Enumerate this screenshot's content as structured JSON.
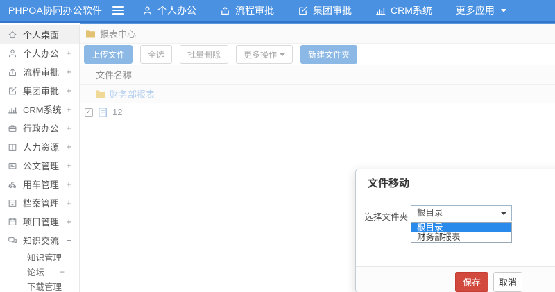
{
  "header": {
    "brand": "PHPOA协同办公软件",
    "nav": [
      {
        "label": "个人办公",
        "icon": "person-icon"
      },
      {
        "label": "流程审批",
        "icon": "process-icon"
      },
      {
        "label": "集团审批",
        "icon": "edit-icon"
      },
      {
        "label": "CRM系统",
        "icon": "chart-icon"
      },
      {
        "label": "更多应用",
        "icon": "caret-down-icon"
      }
    ]
  },
  "sidebar": {
    "items": [
      {
        "label": "个人桌面",
        "icon": "home-icon",
        "expand": "",
        "active": true
      },
      {
        "label": "个人办公",
        "icon": "person-icon",
        "expand": "+"
      },
      {
        "label": "流程审批",
        "icon": "process-icon",
        "expand": "+"
      },
      {
        "label": "集团审批",
        "icon": "edit-icon",
        "expand": "+"
      },
      {
        "label": "CRM系统",
        "icon": "chart-icon",
        "expand": "+"
      },
      {
        "label": "行政办公",
        "icon": "briefcase-icon",
        "expand": "+"
      },
      {
        "label": "人力资源",
        "icon": "book-icon",
        "expand": "+"
      },
      {
        "label": "公文管理",
        "icon": "document-icon",
        "expand": "+"
      },
      {
        "label": "用车管理",
        "icon": "car-icon",
        "expand": "+"
      },
      {
        "label": "档案管理",
        "icon": "archive-icon",
        "expand": "+"
      },
      {
        "label": "项目管理",
        "icon": "project-icon",
        "expand": "+"
      },
      {
        "label": "知识交流",
        "icon": "chat-icon",
        "expand": "−"
      }
    ],
    "subitems": [
      {
        "label": "知识管理",
        "expand": ""
      },
      {
        "label": "论坛",
        "expand": "+"
      },
      {
        "label": "下载管理",
        "expand": ""
      }
    ]
  },
  "content": {
    "breadcrumb": "报表中心",
    "toolbar": {
      "upload": "上传文件",
      "select_all": "全选",
      "batch_delete": "批量删除",
      "more_actions": "更多操作",
      "new_folder": "新建文件夹"
    },
    "table": {
      "name_header": "文件名称",
      "folder_name": "财务部报表",
      "file_name": "12",
      "file_checked": "✓"
    }
  },
  "modal": {
    "title": "文件移动",
    "label": "选择文件夹",
    "select_value": "根目录",
    "options": [
      "根目录",
      "财务部报表"
    ],
    "save": "保存",
    "cancel": "取消"
  },
  "colors": {
    "header_blue": "#4a91e2",
    "header_border": "#3276cc",
    "button_blue": "#8cb8e6",
    "save_red": "#d24a3e",
    "option_highlight": "#2a8aec",
    "folder_yellow": "#e4c273"
  }
}
